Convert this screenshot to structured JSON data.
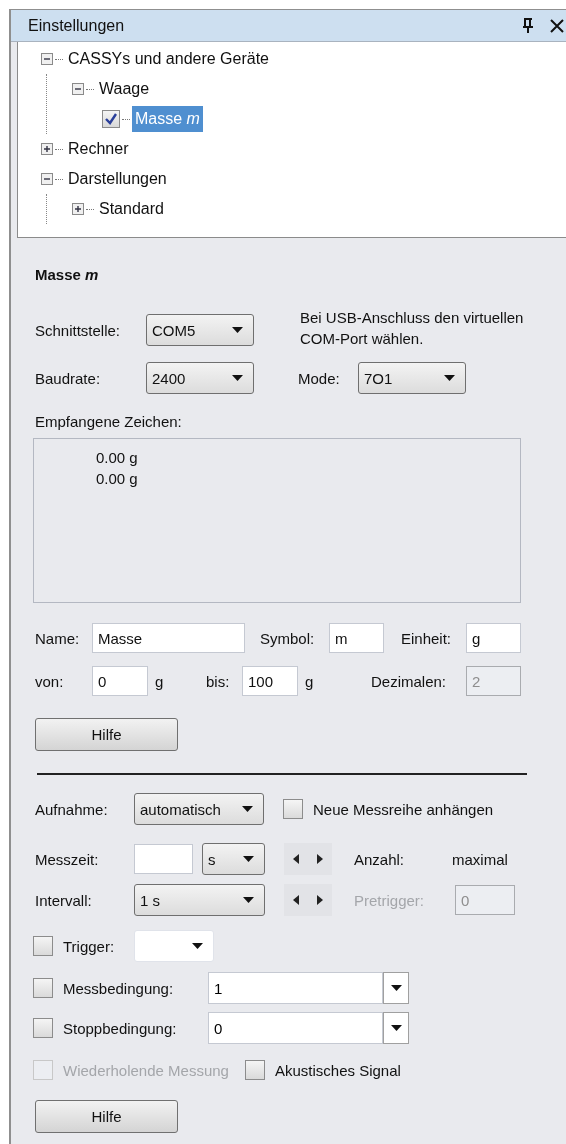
{
  "panel": {
    "title": "Einstellungen"
  },
  "tree": [
    {
      "label": "CASSYs und andere Geräte",
      "kind": "node",
      "expanded": true,
      "selected": false,
      "children": [
        {
          "label": "Waage",
          "kind": "node",
          "expanded": true,
          "selected": false,
          "children": [
            {
              "label": "Masse *m*",
              "kind": "checkbox",
              "checked": true,
              "selected": true
            }
          ]
        }
      ]
    },
    {
      "label": "Rechner",
      "kind": "node",
      "expanded": false,
      "selected": false
    },
    {
      "label": "Darstellungen",
      "kind": "node",
      "expanded": true,
      "selected": false,
      "children": [
        {
          "label": "Standard",
          "kind": "node",
          "expanded": false,
          "selected": false
        }
      ]
    }
  ],
  "device": {
    "heading": "Masse *m*",
    "interface": {
      "label": "Schnittstelle:",
      "value": "COM5"
    },
    "note": "Bei USB-Anschluss den virtuellen COM-Port wählen.",
    "baudrate": {
      "label": "Baudrate:",
      "value": "2400"
    },
    "mode": {
      "label": "Mode:",
      "value": "7O1"
    },
    "received": {
      "label": "Empfangene Zeichen:",
      "lines": [
        "0.00 g",
        "0.00 g"
      ]
    },
    "name": {
      "label": "Name:",
      "value": "Masse"
    },
    "symbol": {
      "label": "Symbol:",
      "value": "m"
    },
    "unit": {
      "label": "Einheit:",
      "value": "g"
    },
    "from": {
      "label": "von:",
      "value": "0",
      "unit": "g"
    },
    "to": {
      "label": "bis:",
      "value": "100",
      "unit": "g"
    },
    "decimals": {
      "label": "Dezimalen:",
      "value": "2",
      "disabled": true
    },
    "help_button": "Hilfe"
  },
  "measurement": {
    "recording": {
      "label": "Aufnahme:",
      "value": "automatisch"
    },
    "append": {
      "label": "Neue Messreihe anhängen",
      "checked": false,
      "disabled": false
    },
    "time": {
      "label": "Messzeit:",
      "unit": "s"
    },
    "count": {
      "label": "Anzahl:",
      "value": "maximal"
    },
    "interval": {
      "label": "Intervall:",
      "value": "1 s"
    },
    "pretrigger": {
      "label": "Pretrigger:",
      "value": "0",
      "disabled": true
    },
    "trigger": {
      "label": "Trigger:",
      "checked": false,
      "disabled": false
    },
    "condition": {
      "label": "Messbedingung:",
      "value": "1",
      "checked": false,
      "disabled": false
    },
    "stop": {
      "label": "Stoppbedingung:",
      "value": "0",
      "checked": false,
      "disabled": false
    },
    "repeat": {
      "label": "Wiederholende Messung",
      "checked": false,
      "disabled": true
    },
    "signal": {
      "label": "Akustisches Signal",
      "checked": false,
      "disabled": false
    },
    "help_button": "Hilfe"
  }
}
